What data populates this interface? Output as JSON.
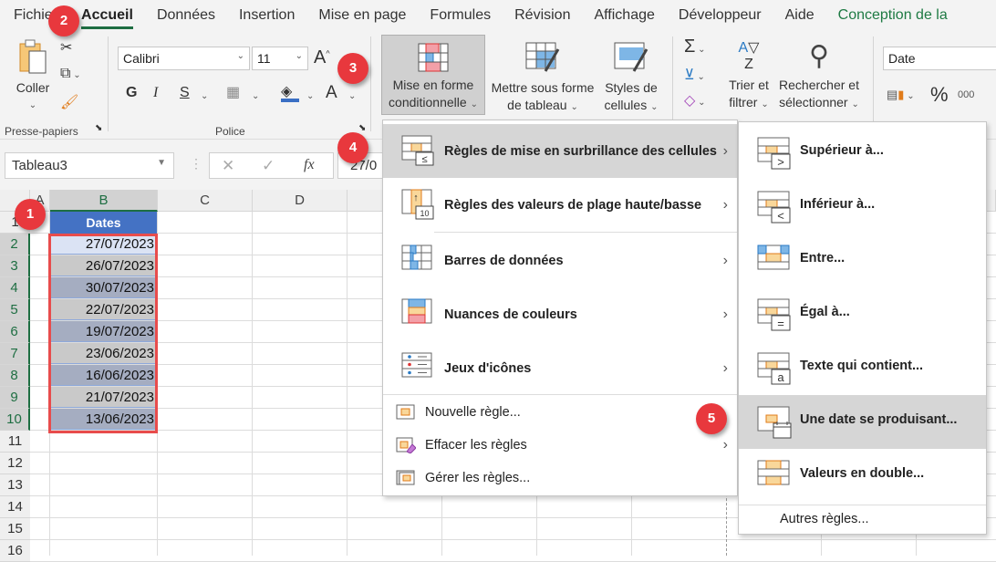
{
  "tabs": [
    {
      "label": "Fichier",
      "active": false
    },
    {
      "label": "Accueil",
      "active": true
    },
    {
      "label": "Données",
      "active": false
    },
    {
      "label": "Insertion",
      "active": false
    },
    {
      "label": "Mise en page",
      "active": false
    },
    {
      "label": "Formules",
      "active": false
    },
    {
      "label": "Révision",
      "active": false
    },
    {
      "label": "Affichage",
      "active": false
    },
    {
      "label": "Développeur",
      "active": false
    },
    {
      "label": "Aide",
      "active": false
    },
    {
      "label": "Conception de la",
      "active": false,
      "contextual": true
    }
  ],
  "ribbon": {
    "clipboard": {
      "paste_label": "Coller",
      "group_label": "Presse-papiers"
    },
    "font": {
      "font_name": "Calibri",
      "font_size": "11",
      "bold": "G",
      "italic": "I",
      "underline": "S",
      "font_color_glyph": "A",
      "grow": "A",
      "group_label": "Police"
    },
    "styles": {
      "conditional_format_l1": "Mise en forme",
      "conditional_format_l2": "conditionnelle",
      "format_table_l1": "Mettre sous forme",
      "format_table_l2": "de tableau",
      "cell_styles_l1": "Styles de",
      "cell_styles_l2": "cellules"
    },
    "editing": {
      "sigma": "Σ",
      "sort_l1": "Trier et",
      "sort_l2": "filtrer",
      "find_l1": "Rechercher et",
      "find_l2": "sélectionner"
    },
    "number": {
      "format": "Date",
      "percent": "%",
      "thousands": "000"
    }
  },
  "formula_bar": {
    "name_box": "Tableau3",
    "formula": "27/0",
    "cancel": "✕",
    "enter": "✓",
    "fx": "fx"
  },
  "sheet": {
    "columns": [
      "A",
      "B",
      "C",
      "D"
    ],
    "header_cell": "Dates",
    "rows": [
      "1",
      "2",
      "3",
      "4",
      "5",
      "6",
      "7",
      "8",
      "9",
      "10",
      "11",
      "12",
      "13",
      "14",
      "15",
      "16"
    ],
    "dates": [
      "27/07/2023",
      "26/07/2023",
      "30/07/2023",
      "22/07/2023",
      "19/07/2023",
      "23/06/2023",
      "16/06/2023",
      "21/07/2023",
      "13/06/2023"
    ]
  },
  "menu": {
    "items": [
      {
        "label": "Règles de mise en surbrillance des cellules",
        "icon": "highlight-cells-rules-icon"
      },
      {
        "label": "Règles des valeurs de plage haute/basse",
        "icon": "top-bottom-rules-icon"
      },
      {
        "label": "Barres de données",
        "icon": "data-bars-icon"
      },
      {
        "label": "Nuances de couleurs",
        "icon": "color-scales-icon"
      },
      {
        "label": "Jeux d'icônes",
        "icon": "icon-sets-icon"
      }
    ],
    "small_items": [
      {
        "label": "Nouvelle règle...",
        "icon": "new-rule-icon"
      },
      {
        "label": "Effacer les règles",
        "icon": "clear-rules-icon"
      },
      {
        "label": "Gérer les règles...",
        "icon": "manage-rules-icon"
      }
    ]
  },
  "submenu": {
    "items": [
      {
        "label": "Supérieur à...",
        "glyph": ">"
      },
      {
        "label": "Inférieur à...",
        "glyph": "<"
      },
      {
        "label": "Entre...",
        "glyph": ""
      },
      {
        "label": "Égal à...",
        "glyph": "="
      },
      {
        "label": "Texte qui contient...",
        "glyph": "a"
      },
      {
        "label": "Une date se produisant...",
        "glyph": ""
      },
      {
        "label": "Valeurs en double...",
        "glyph": ""
      }
    ],
    "more": "Autres règles..."
  },
  "badges": [
    "1",
    "2",
    "3",
    "4",
    "5"
  ],
  "colors": {
    "accent_green": "#1e6e42",
    "table_header": "#4472c4",
    "badge_red": "#e8383d",
    "selection_red": "#e84c4c"
  }
}
